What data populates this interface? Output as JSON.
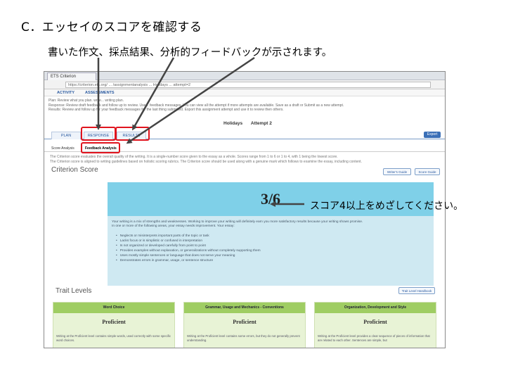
{
  "slide": {
    "title": "C．エッセイのスコアを確認する",
    "subtitle": "書いた作文、採点結果、分析的フィードバックが示されます。",
    "score_note": "スコア4以上をめざしてください。"
  },
  "browser": {
    "tab_title": "ETS Criterion",
    "address": "https://criterion.ets.org/ ... /assignmentanalysis ... Holidays ... attempt=2"
  },
  "site_nav": {
    "activity": "ACTIVITY",
    "assessments": "ASSESSMENTS"
  },
  "instructions": {
    "line1": "Plan: Review what you plan. write... writing plan.",
    "line2": "Response: Review draft feedback and follow up to review. Use... feedback messages. You can view all the attempt if more attempts are available. Save as a draft or Submit as a new attempt.",
    "line3": "Results: Review and follow up for your feedback messages for the last thing submitted. Export this assignment attempt and use it to review then others."
  },
  "prompt": {
    "title": "Holidays",
    "attempt": "Attempt 2"
  },
  "tabs": {
    "plan": "PLAN",
    "response": "RESPONSE",
    "results": "RESULTS",
    "export": "Export"
  },
  "subtabs": {
    "score_analysis": "Score Analysis",
    "feedback_analysis": "Feedback Analysis"
  },
  "description": {
    "line1": "The Criterion score evaluates the overall quality of the writing. It is a single-number score given to the essay as a whole. Scores range from 1 to 6 or 1 to 4, with 1 being the lowest score.",
    "line2": "The Criterion score is aligned to writing guidelines based on holistic scoring rubrics. The Criterion score should be used along with a genuine mark which follows to examine the essay, including content."
  },
  "criterion": {
    "heading": "Criterion Score",
    "writers_button": "Writer's Guide",
    "score_guide_button": "Score Guide",
    "score": "3/6",
    "summary_1": "Your writing is a mix of strengths and weaknesses. Working to improve your writing will definitely earn you more satisfactory results because your writing shows promise.",
    "summary_2": "In one or more of the following areas, your essay needs improvement. Your essay:",
    "bullets": [
      "Neglects or misinterprets important parts of the topic or task",
      "Lacks focus or is simplistic or confused in interpretation",
      "Is not organized or developed carefully from point to point",
      "Provides examples without explanation, or generalizations without completely supporting them",
      "Uses mostly simple sentences or language that does not serve your meaning",
      "Demonstrates errors in grammar, usage, or sentence structure"
    ]
  },
  "traits": {
    "heading": "Trait Levels",
    "handbook_button": "Trait Level Handbook",
    "items": [
      {
        "name": "Word Choice",
        "level": "Proficient",
        "text": "Writing at the Proficient level contains simple words, used correctly with some specific word choices."
      },
      {
        "name": "Grammar, Usage and Mechanics - Conventions",
        "level": "Proficient",
        "text": "Writing at the Proficient level contains some errors, but they do not generally prevent understanding."
      },
      {
        "name": "Organization, Development and Style",
        "level": "Proficient",
        "text": "Writing at the Proficient level provides a clear sequence of pieces of information that are related to each other. Sentences are simple, but"
      }
    ]
  },
  "colors": {
    "highlight": "#e0141e",
    "score_banner": "#7fd0e8",
    "score_panel": "#cfe9f2",
    "trait_header": "#9fcd63",
    "trait_body": "#e8f3d6",
    "link_blue": "#2a5aa0",
    "export_button": "#3a6fb7"
  }
}
